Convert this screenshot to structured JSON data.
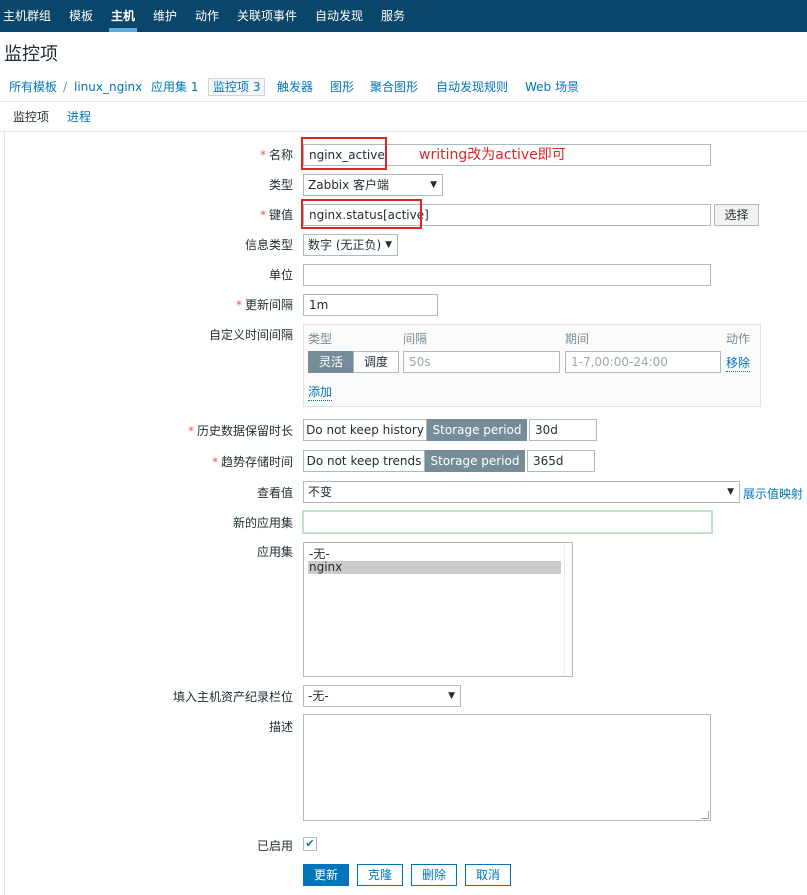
{
  "nav": {
    "items": [
      "主机群组",
      "模板",
      "主机",
      "维护",
      "动作",
      "关联项事件",
      "自动发现",
      "服务"
    ],
    "active": "主机"
  },
  "page_title": "监控项",
  "breadcrumbs": {
    "all_templates": "所有模板",
    "separator": "/",
    "host": "linux_nginx",
    "applications": "应用集 1",
    "items": "监控项 3",
    "triggers": "触发器",
    "graphs": "图形",
    "aggregated_graphs": "聚合图形",
    "discovery": "自动发现规则",
    "web": "Web 场景"
  },
  "subtabs": {
    "item": "监控项",
    "process": "进程"
  },
  "form": {
    "name_label": "名称",
    "name_value": "nginx_active",
    "type_label": "类型",
    "type_value": "Zabbix 客户端",
    "key_label": "键值",
    "key_value": "nginx.status[active]",
    "key_select_button": "选择",
    "info_type_label": "信息类型",
    "info_type_value": "数字 (无正负)",
    "units_label": "单位",
    "units_value": "",
    "update_interval_label": "更新间隔",
    "update_interval_value": "1m",
    "custom_intervals_label": "自定义时间间隔",
    "custom_intervals": {
      "col_type": "类型",
      "col_interval": "间隔",
      "col_period": "期间",
      "col_action": "动作",
      "flexible": "灵活",
      "scheduling": "调度",
      "interval_placeholder": "50s",
      "period_placeholder": "1-7,00:00-24:00",
      "remove": "移除",
      "add": "添加"
    },
    "history_label": "历史数据保留时长",
    "history_no_keep": "Do not keep history",
    "history_storage": "Storage period",
    "history_value": "30d",
    "trends_label": "趋势存储时间",
    "trends_no_keep": "Do not keep trends",
    "trends_storage": "Storage period",
    "trends_value": "365d",
    "show_value_label": "查看值",
    "show_value_value": "不变",
    "show_value_mapping_link": "展示值映射",
    "new_application_label": "新的应用集",
    "new_application_value": "",
    "applications_label": "应用集",
    "applications_options": [
      "-无-",
      "nginx"
    ],
    "applications_selected": "nginx",
    "inventory_label": "填入主机资产纪录栏位",
    "inventory_value": "-无-",
    "description_label": "描述",
    "description_value": "",
    "enabled_label": "已启用",
    "enabled_checked": true,
    "buttons": {
      "update": "更新",
      "clone": "克隆",
      "delete": "删除",
      "cancel": "取消"
    }
  },
  "annotation": {
    "text": "writing改为active即可",
    "color": "#e02424"
  },
  "colors": {
    "nav_bg": "#0a466a",
    "link": "#0275b8",
    "primary": "#0275b8",
    "required": "#e45959",
    "toggle_on": "#768d99"
  }
}
